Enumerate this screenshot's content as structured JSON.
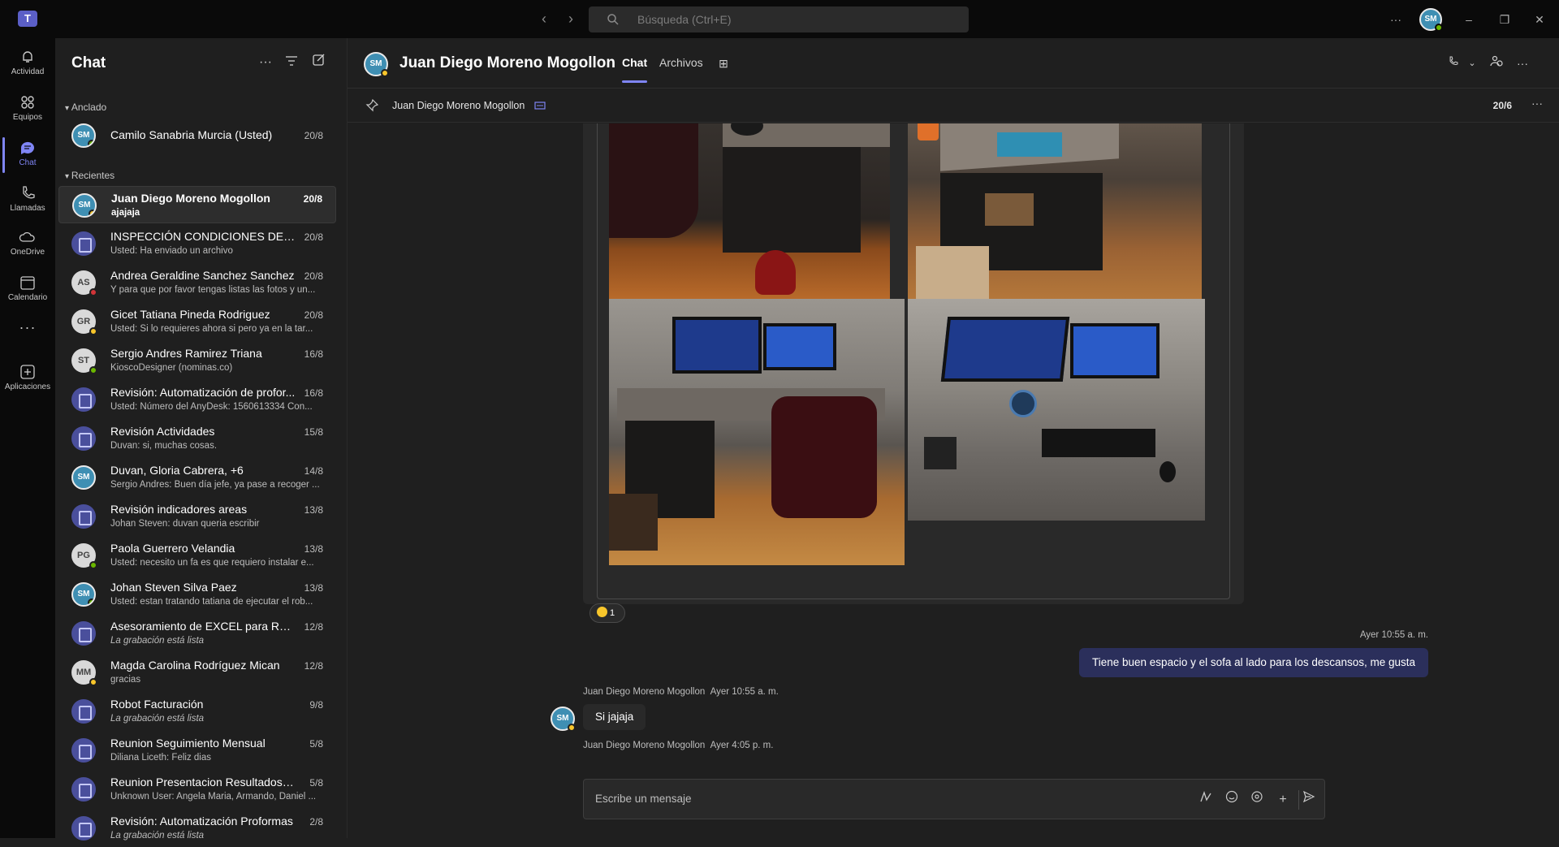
{
  "titlebar": {
    "search_placeholder": "Búsqueda (Ctrl+E)",
    "avatar_initials": "SM"
  },
  "rail": [
    {
      "label": "Actividad",
      "icon": "bell-icon"
    },
    {
      "label": "Equipos",
      "icon": "teams-icon"
    },
    {
      "label": "Chat",
      "icon": "chat-icon",
      "active": true
    },
    {
      "label": "Llamadas",
      "icon": "phone-icon"
    },
    {
      "label": "OneDrive",
      "icon": "cloud-icon"
    },
    {
      "label": "Calendario",
      "icon": "calendar-icon"
    },
    {
      "label": "Aplicaciones",
      "icon": "add-apps-icon"
    }
  ],
  "sidebar": {
    "title": "Chat",
    "pinned_label": "Anclado",
    "recent_label": "Recientes",
    "pinned": [
      {
        "name": "Camilo Sanabria Murcia (Usted)",
        "date": "20/8",
        "initials": "SM",
        "status": "green",
        "type": "photo"
      }
    ],
    "recent": [
      {
        "name": "Juan Diego Moreno Mogollon",
        "preview": "ajajaja",
        "date": "20/8",
        "initials": "SM",
        "status": "yellow",
        "type": "photo",
        "selected": true
      },
      {
        "name": "INSPECCIÓN CONDICIONES DE TR...",
        "preview": "Usted: Ha enviado un archivo",
        "date": "20/8",
        "type": "meet"
      },
      {
        "name": "Andrea Geraldine Sanchez Sanchez",
        "preview": "Y para que por favor tengas listas las fotos y un...",
        "date": "20/8",
        "initials": "AS",
        "status": "red",
        "type": "init"
      },
      {
        "name": "Gicet Tatiana Pineda Rodriguez",
        "preview": "Usted: Si lo requieres ahora si pero ya en la tar...",
        "date": "20/8",
        "initials": "GR",
        "status": "yellow",
        "type": "init"
      },
      {
        "name": "Sergio Andres Ramirez Triana",
        "preview": "KioscoDesigner (nominas.co)",
        "date": "16/8",
        "initials": "ST",
        "status": "green",
        "type": "init"
      },
      {
        "name": "Revisión: Automatización de profor...",
        "preview": "Usted: Número del AnyDesk: 1560613334   Con...",
        "date": "16/8",
        "type": "meet"
      },
      {
        "name": "Revisión Actividades",
        "preview": "Duvan: si, muchas cosas.",
        "date": "15/8",
        "type": "meet"
      },
      {
        "name": "Duvan, Gloria Cabrera, +6",
        "preview": "Sergio Andres: Buen día jefe, ya pase a recoger ...",
        "date": "14/8",
        "initials": "SM",
        "type": "photo"
      },
      {
        "name": "Revisión indicadores areas",
        "preview": "Johan Steven: duvan queria escribir",
        "date": "13/8",
        "type": "meet"
      },
      {
        "name": "Paola Guerrero Velandia",
        "preview": "Usted: necesito un fa es que requiero instalar e...",
        "date": "13/8",
        "initials": "PG",
        "status": "green",
        "type": "init"
      },
      {
        "name": "Johan Steven Silva Paez",
        "preview": "Usted: estan tratando tatiana de ejecutar el rob...",
        "date": "13/8",
        "initials": "SM",
        "status": "green",
        "type": "photo"
      },
      {
        "name": "Asesoramiento de EXCEL para RETIE",
        "preview": "La grabación está lista",
        "date": "12/8",
        "type": "meet",
        "italic": true
      },
      {
        "name": "Magda Carolina Rodríguez Mican",
        "preview": "gracias",
        "date": "12/8",
        "initials": "MM",
        "status": "yellow",
        "type": "init"
      },
      {
        "name": "Robot Facturación",
        "preview": "La grabación está lista",
        "date": "9/8",
        "type": "meet",
        "italic": true
      },
      {
        "name": "Reunion Seguimiento Mensual",
        "preview": "Diliana Liceth: Feliz dias",
        "date": "5/8",
        "type": "meet"
      },
      {
        "name": "Reunion Presentacion Resultados M...",
        "preview": "Unknown User: Angela Maria, Armando, Daniel ...",
        "date": "5/8",
        "type": "meet"
      },
      {
        "name": "Revisión: Automatización Proformas",
        "preview": "La grabación está lista",
        "date": "2/8",
        "type": "meet",
        "italic": true
      }
    ]
  },
  "conversation": {
    "name": "Juan Diego Moreno Mogollon",
    "avatar_initials": "SM",
    "tabs": [
      "Chat",
      "Archivos"
    ],
    "pinned_name": "Juan Diego Moreno Mogollon",
    "pinned_date": "20/6",
    "reaction_count": "1",
    "messages": [
      {
        "meta": "Ayer 10:55 a. m.",
        "text": "Tiene buen espacio y el sofa al lado para los descansos, me gusta",
        "mine": true
      },
      {
        "sender": "Juan Diego Moreno Mogollon",
        "time": "Ayer 10:55 a. m.",
        "text": "Si jajaja"
      },
      {
        "sender": "Juan Diego Moreno Mogollon",
        "time": "Ayer 4:05 p. m."
      }
    ],
    "compose_placeholder": "Escribe un mensaje"
  }
}
